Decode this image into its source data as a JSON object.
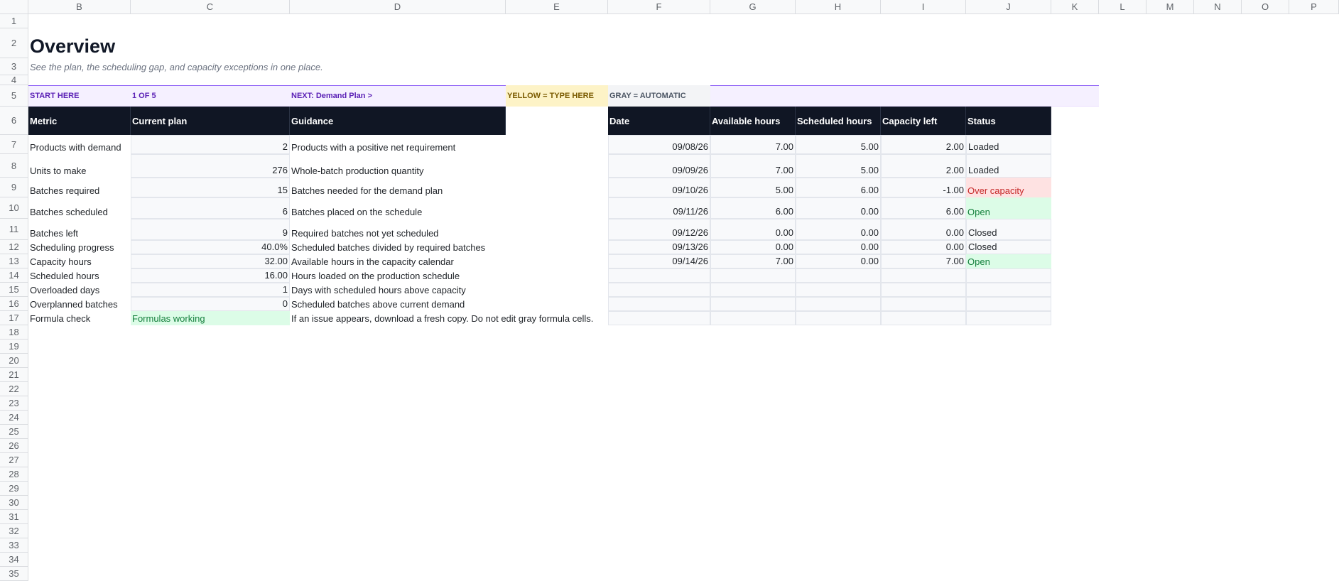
{
  "columns": [
    "B",
    "C",
    "D",
    "E",
    "F",
    "G",
    "H",
    "I",
    "J",
    "K",
    "L",
    "M",
    "N",
    "O",
    "P"
  ],
  "rows": [
    "1",
    "2",
    "3",
    "4",
    "5",
    "6",
    "7",
    "8",
    "9",
    "10",
    "11",
    "12",
    "13",
    "14",
    "15",
    "16",
    "17",
    "18",
    "19",
    "20",
    "21",
    "22",
    "23",
    "24",
    "25",
    "26",
    "27",
    "28",
    "29",
    "30",
    "31",
    "32",
    "33",
    "34",
    "35"
  ],
  "title": "Overview",
  "subtitle": "See the plan, the scheduling gap, and capacity exceptions in one place.",
  "nav": {
    "start": "START HERE",
    "step": "1 OF 5",
    "next": "NEXT: Demand Plan  >",
    "yellow_key": "YELLOW = TYPE HERE",
    "gray_key": "GRAY = AUTOMATIC"
  },
  "metrics_headers": [
    "Metric",
    "Current plan",
    "Guidance"
  ],
  "metrics": [
    {
      "metric": "Products with demand",
      "value": "2",
      "guidance": "Products with a positive net requirement"
    },
    {
      "metric": "Units to make",
      "value": "276",
      "guidance": "Whole-batch production quantity"
    },
    {
      "metric": "Batches required",
      "value": "15",
      "guidance": "Batches needed for the demand plan"
    },
    {
      "metric": "Batches scheduled",
      "value": "6",
      "guidance": "Batches placed on the schedule"
    },
    {
      "metric": "Batches left",
      "value": "9",
      "guidance": "Required batches not yet scheduled"
    },
    {
      "metric": "Scheduling progress",
      "value": "40.0%",
      "guidance": "Scheduled batches divided by required batches"
    },
    {
      "metric": "Capacity hours",
      "value": "32.00",
      "guidance": "Available hours in the capacity calendar"
    },
    {
      "metric": "Scheduled hours",
      "value": "16.00",
      "guidance": "Hours loaded on the production schedule"
    },
    {
      "metric": "Overloaded days",
      "value": "1",
      "guidance": "Days with scheduled hours above capacity"
    },
    {
      "metric": "Overplanned batches",
      "value": "0",
      "guidance": "Scheduled batches above current demand"
    }
  ],
  "formula_check": {
    "label": "Formula check",
    "status": "Formulas working",
    "note": "If an issue appears, download a fresh copy. Do not edit gray formula cells."
  },
  "capacity_headers": [
    "Date",
    "Available hours",
    "Scheduled hours",
    "Capacity left",
    "Status"
  ],
  "capacity": [
    {
      "date": "09/08/26",
      "available": "7.00",
      "scheduled": "5.00",
      "left": "2.00",
      "status": "Loaded",
      "kind": "loaded"
    },
    {
      "date": "09/09/26",
      "available": "7.00",
      "scheduled": "5.00",
      "left": "2.00",
      "status": "Loaded",
      "kind": "loaded"
    },
    {
      "date": "09/10/26",
      "available": "5.00",
      "scheduled": "6.00",
      "left": "-1.00",
      "status": "Over capacity",
      "kind": "over"
    },
    {
      "date": "09/11/26",
      "available": "6.00",
      "scheduled": "0.00",
      "left": "6.00",
      "status": "Open",
      "kind": "open"
    },
    {
      "date": "09/12/26",
      "available": "0.00",
      "scheduled": "0.00",
      "left": "0.00",
      "status": "Closed",
      "kind": "closed"
    },
    {
      "date": "09/13/26",
      "available": "0.00",
      "scheduled": "0.00",
      "left": "0.00",
      "status": "Closed",
      "kind": "closed"
    },
    {
      "date": "09/14/26",
      "available": "7.00",
      "scheduled": "0.00",
      "left": "7.00",
      "status": "Open",
      "kind": "open"
    }
  ],
  "colors": {
    "header_bg": "#101624",
    "accent_purple": "#8b5cf6",
    "over_bg": "#fee2e2",
    "over_text": "#c62828",
    "open_bg": "#dcfce7",
    "open_text": "#15803d",
    "yellow_key_bg": "#fdf3c7"
  }
}
